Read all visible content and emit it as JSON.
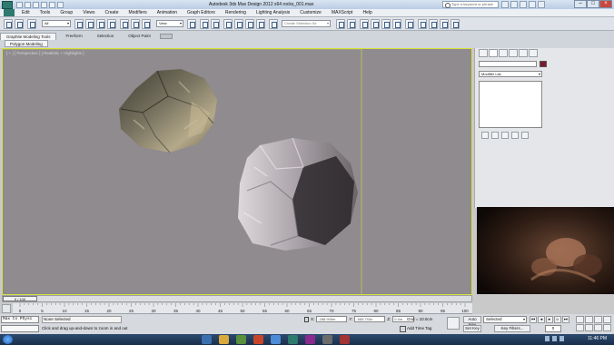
{
  "window": {
    "title": "Autodesk 3ds Max Design 2012 x64     rocks_001.max",
    "search_placeholder": "Type a keyword or phrase"
  },
  "menu": [
    "Edit",
    "Tools",
    "Group",
    "Views",
    "Create",
    "Modifiers",
    "Animation",
    "Graph Editors",
    "Rendering",
    "Lighting Analysis",
    "Customize",
    "MAXScript",
    "Help"
  ],
  "toolbar": {
    "filter_value": "All",
    "ref_coord_value": "View",
    "named_selection_placeholder": "Create Selection Se"
  },
  "ribbon": {
    "tabs": [
      "Graphite Modeling Tools",
      "Freeform",
      "Selection",
      "Object Paint"
    ],
    "panel": "Polygon Modeling"
  },
  "viewport": {
    "label": "[ + ] [ Perspective ] [ Realistic + Highlights ]"
  },
  "command_panel": {
    "modifier_list_label": "Modifier List",
    "object_color": "#7a1a2e"
  },
  "timeline": {
    "slider_label": "0 / 100",
    "ticks": [
      "0",
      "5",
      "10",
      "15",
      "20",
      "25",
      "30",
      "35",
      "40",
      "45",
      "50",
      "55",
      "60",
      "65",
      "70",
      "75",
      "80",
      "85",
      "90",
      "95",
      "100"
    ]
  },
  "status": {
    "listener_label": "Max to Physc",
    "selection_text": "None Selected",
    "prompt_text": "Click and drag up-and-down to zoom in and out",
    "x_label": "X:",
    "y_label": "Y:",
    "z_label": "Z:",
    "x_value": "-288.909m",
    "y_value": "-565.793n",
    "z_value": "0.0m",
    "grid_text": "Grid = 10.0cm",
    "add_time_tag": "Add Time Tag",
    "auto_key": "Auto Key",
    "set_key": "Set Key",
    "selected_option": "Selected",
    "key_filters": "Key Filters...",
    "frame_value": "0"
  },
  "taskbar": {
    "clock": "11:46 PM"
  }
}
